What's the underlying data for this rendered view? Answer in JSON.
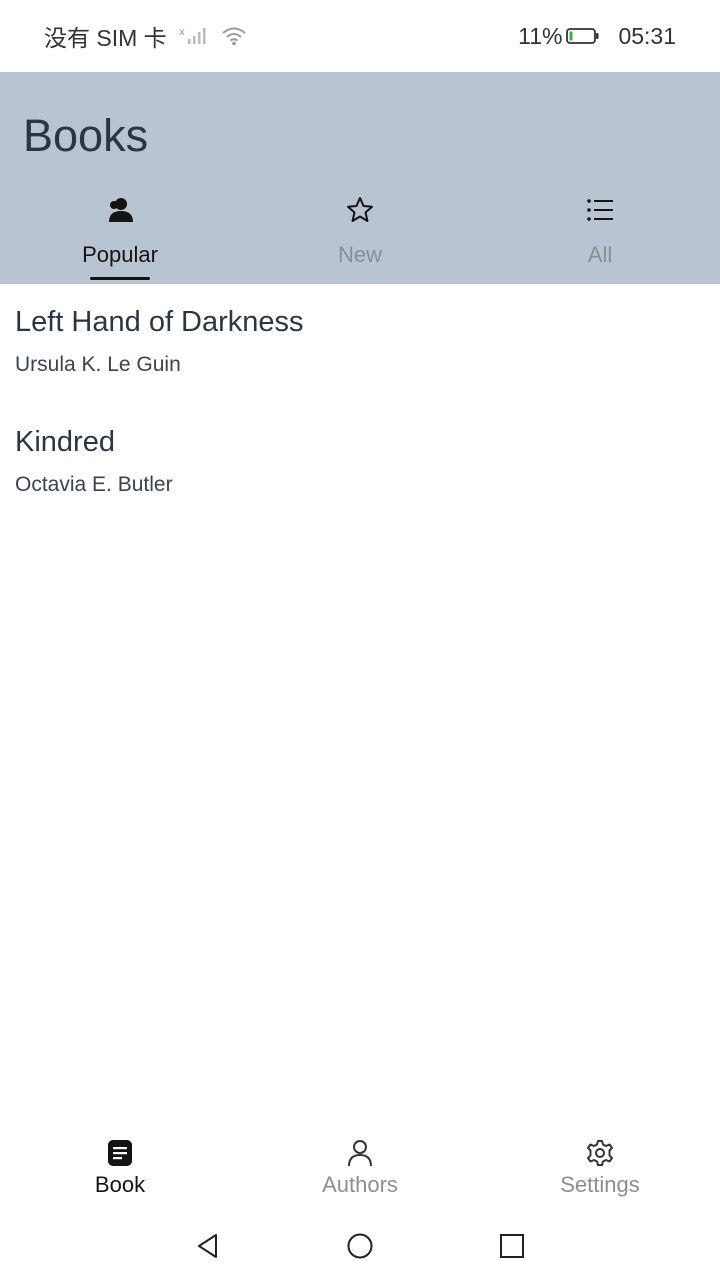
{
  "status_bar": {
    "carrier": "没有 SIM 卡",
    "battery_percent": "11%",
    "time": "05:31",
    "icons": [
      "signal-icon",
      "wifi-icon",
      "battery-icon"
    ]
  },
  "app_bar": {
    "title": "Books",
    "background_color": "#b8c4d1",
    "tabs": [
      {
        "label": "Popular",
        "icon": "person-icon",
        "active": true
      },
      {
        "label": "New",
        "icon": "star-icon",
        "active": false
      },
      {
        "label": "All",
        "icon": "list-icon",
        "active": false
      }
    ]
  },
  "books": [
    {
      "title": "Left Hand of Darkness",
      "author": "Ursula K. Le Guin"
    },
    {
      "title": "Kindred",
      "author": "Octavia E. Butler"
    }
  ],
  "bottom_nav": {
    "items": [
      {
        "label": "Book",
        "icon": "book-icon",
        "active": true
      },
      {
        "label": "Authors",
        "icon": "person-outline-icon",
        "active": false
      },
      {
        "label": "Settings",
        "icon": "gear-icon",
        "active": false
      }
    ]
  },
  "system_nav": {
    "icons": [
      "back-icon",
      "home-icon",
      "recents-icon"
    ]
  }
}
